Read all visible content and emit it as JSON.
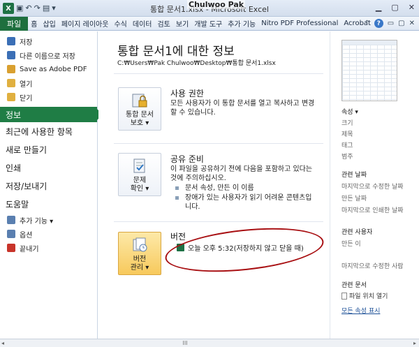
{
  "window": {
    "app_title": "통합 문서1.xlsx - Microsoft Excel",
    "username": "Chulwoo Pak",
    "logo": "X",
    "qat_icons": [
      "save-icon",
      "undo-icon",
      "redo-icon",
      "print-preview-icon",
      "customize-icon"
    ],
    "window_buttons": [
      "minimize-icon",
      "restore-icon",
      "close-icon"
    ]
  },
  "menubar": {
    "file_tab": "파일",
    "items": [
      "홈",
      "삽입",
      "페이지 레이아웃",
      "수식",
      "데이터",
      "검토",
      "보기",
      "개발 도구",
      "추가 기능",
      "Nitro PDF Professional",
      "Acrobat"
    ],
    "help": "?"
  },
  "leftnav": {
    "top_items": [
      {
        "label": "저장",
        "icon": "save-icon",
        "color": "#3b6fb6"
      },
      {
        "label": "다른 이름으로 저장",
        "icon": "save-as-icon",
        "color": "#3b6fb6"
      },
      {
        "label": "Save as Adobe PDF",
        "icon": "pdf-icon",
        "color": "#d9a030"
      },
      {
        "label": "열기",
        "icon": "open-folder-icon",
        "color": "#e0b040"
      },
      {
        "label": "닫기",
        "icon": "close-folder-icon",
        "color": "#e0b040"
      }
    ],
    "active": "정보",
    "big_items": [
      "최근에 사용한 항목",
      "새로 만들기",
      "인쇄",
      "저장/보내기",
      "도움말"
    ],
    "bottom_items": [
      {
        "label": "추가 기능 ▾",
        "icon": "addins-icon",
        "color": "#5a7fb0"
      },
      {
        "label": "옵션",
        "icon": "options-icon",
        "color": "#5a7fb0"
      },
      {
        "label": "끝내기",
        "icon": "exit-icon",
        "color": "#c8342a"
      }
    ]
  },
  "main": {
    "title": "통합 문서1에 대한 정보",
    "path": "C:₩Users₩Pak Chulwoo₩Desktop₩통합 문서1.xlsx",
    "permissions": {
      "button_line1": "통합 문서",
      "button_line2": "보호 ▾",
      "title": "사용 권한",
      "text": "모든 사용자가 이 통합 문서를 열고 복사하고 변경할 수 있습니다."
    },
    "prepare": {
      "button_line1": "문제",
      "button_line2": "확인 ▾",
      "title": "공유 준비",
      "text": "이 파일을 공유하기 전에 다음을 포함하고 있다는 것에 주의하십시오.",
      "bullets": [
        "문서 속성, 만든 이 이름",
        "장애가 있는 사용자가 읽기 어려운 콘텐츠입니다."
      ]
    },
    "versions": {
      "button_line1": "버전",
      "button_line2": "관리 ▾",
      "title": "버전",
      "entry": "오늘 오후 5:32(저장하지 않고 닫을 때)"
    }
  },
  "rightpanel": {
    "properties_head": "속성 ▾",
    "properties": [
      "크기",
      "제목",
      "태그",
      "범주"
    ],
    "dates_head": "관련 날짜",
    "dates": [
      "마지막으로 수정한 날짜",
      "만든 날짜",
      "마지막으로 인쇄한 날짜"
    ],
    "people_head": "관련 사용자",
    "people": [
      "만든 이",
      "마지막으로 수정한 사람"
    ],
    "docs_head": "관련 문서",
    "open_location": "파일 위치 열기",
    "show_all": "모든 속성 표시"
  },
  "scrollbar": {
    "grip": "III"
  }
}
